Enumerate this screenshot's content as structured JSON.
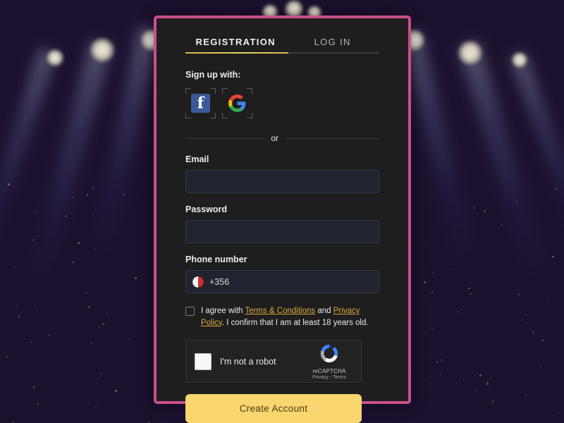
{
  "tabs": {
    "registration": "REGISTRATION",
    "login": "LOG IN"
  },
  "social": {
    "heading": "Sign up with:",
    "facebook_name": "facebook-icon",
    "google_name": "google-icon"
  },
  "divider": {
    "or": "or"
  },
  "form": {
    "email": {
      "label": "Email",
      "value": "",
      "placeholder": ""
    },
    "password": {
      "label": "Password",
      "value": "",
      "placeholder": ""
    },
    "phone": {
      "label": "Phone number",
      "country_code": "+356",
      "flag": "malta-flag-icon",
      "value": "",
      "placeholder": ""
    }
  },
  "terms": {
    "checked": false,
    "prefix": "I agree with ",
    "terms_link": "Terms & Conditions",
    "middle": " and ",
    "privacy_link": "Privacy Policy",
    "suffix": ". I confirm that I am at least 18 years old."
  },
  "recaptcha": {
    "label": "I'm not a robot",
    "brand": "reCAPTCHA",
    "legal": "Privacy - Terms",
    "checked": false
  },
  "submit": {
    "label": "Create Account"
  },
  "colors": {
    "card_border": "#c94f8b",
    "card_background": "#1e1e1e",
    "accent_gold": "#d8b74a",
    "link_gold": "#d9a93c",
    "button_yellow": "#fad66e",
    "button_text": "#4b3a1a",
    "input_background": "#21242e",
    "facebook_blue": "#3b5998"
  }
}
